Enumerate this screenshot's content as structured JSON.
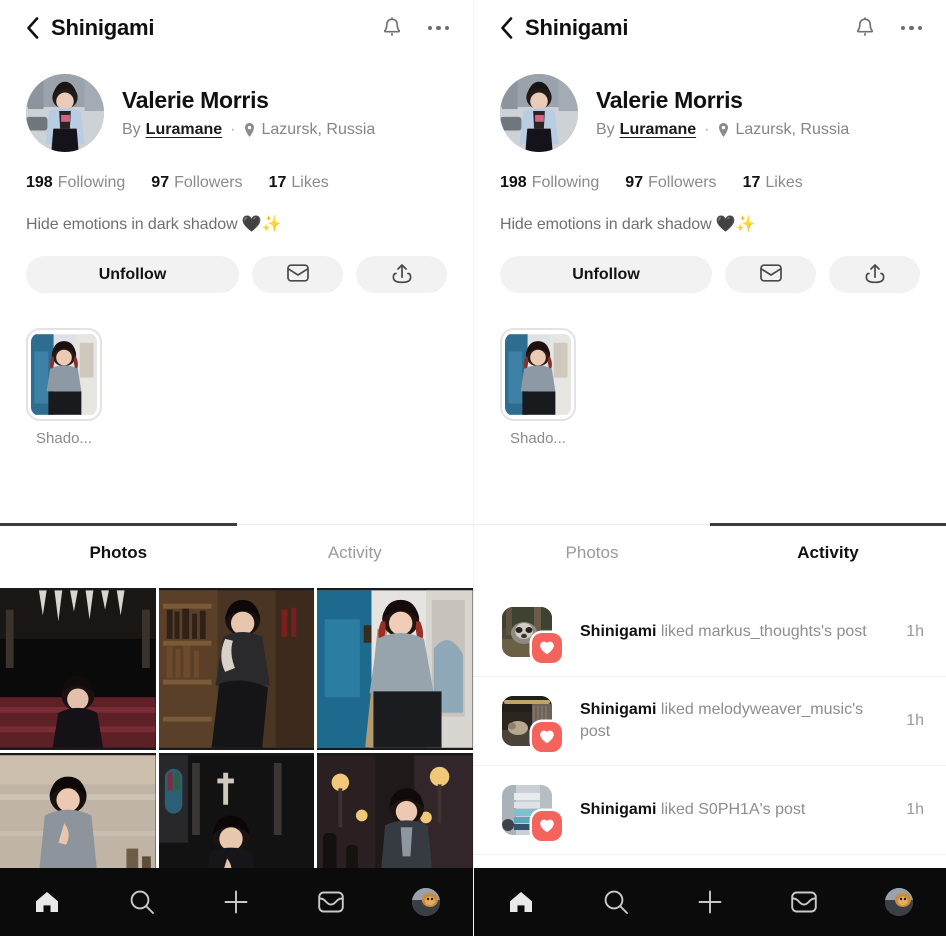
{
  "app": {
    "panel_count": 2,
    "accent_like": "#f4635c",
    "nav_bg": "#0b0b0c",
    "tab_underline": "#3c3c40",
    "button_bg": "#f2f2f3"
  },
  "header": {
    "back_icon": "chevron-left-icon",
    "title": "Shinigami",
    "bell_icon": "bell-icon",
    "more_icon": "more-options-icon"
  },
  "profile": {
    "avatar_alt": "profile-avatar",
    "name": "Valerie Morris",
    "by_label": "By",
    "author": "Luramane",
    "separator": "·",
    "location_icon": "location-pin-icon",
    "location": "Lazursk, Russia",
    "bio": "Hide emotions in dark shadow 🖤✨",
    "stats": [
      {
        "value": "198",
        "label": "Following"
      },
      {
        "value": "97",
        "label": "Followers"
      },
      {
        "value": "17",
        "label": "Likes"
      }
    ],
    "actions": {
      "follow_label": "Unfollow",
      "message_icon": "envelope-icon",
      "share_icon": "share-upload-icon"
    },
    "highlights": [
      {
        "label": "Shado...",
        "thumb": "highlight-thumb-shadow"
      }
    ]
  },
  "tabs": {
    "items": [
      {
        "label": "Photos"
      },
      {
        "label": "Activity"
      }
    ],
    "left_panel_active_index": 0,
    "right_panel_active_index": 1
  },
  "photos": {
    "cells": [
      {
        "name": "photo-theatre"
      },
      {
        "name": "photo-library"
      },
      {
        "name": "photo-studio"
      },
      {
        "name": "photo-lake"
      },
      {
        "name": "photo-cathedral"
      },
      {
        "name": "photo-alley"
      }
    ]
  },
  "activity": {
    "items": [
      {
        "actor": "Shinigami",
        "text": " liked markus_thoughts's post",
        "time": "1h",
        "badge_icon": "heart-icon",
        "thumb": "activity-thumb-raccoon"
      },
      {
        "actor": "Shinigami",
        "text": " liked melodyweaver_music's post",
        "time": "1h",
        "badge_icon": "heart-icon",
        "thumb": "activity-thumb-desk"
      },
      {
        "actor": "Shinigami",
        "text": " liked S0PH1A's post",
        "time": "1h",
        "badge_icon": "heart-icon",
        "thumb": "activity-thumb-books"
      }
    ]
  },
  "bottom_nav": {
    "items": [
      {
        "icon": "home-icon",
        "active": true
      },
      {
        "icon": "search-icon",
        "active": false
      },
      {
        "icon": "plus-icon",
        "active": false
      },
      {
        "icon": "inbox-icon",
        "active": false
      },
      {
        "icon": "profile-avatar-icon",
        "active": false
      }
    ]
  }
}
